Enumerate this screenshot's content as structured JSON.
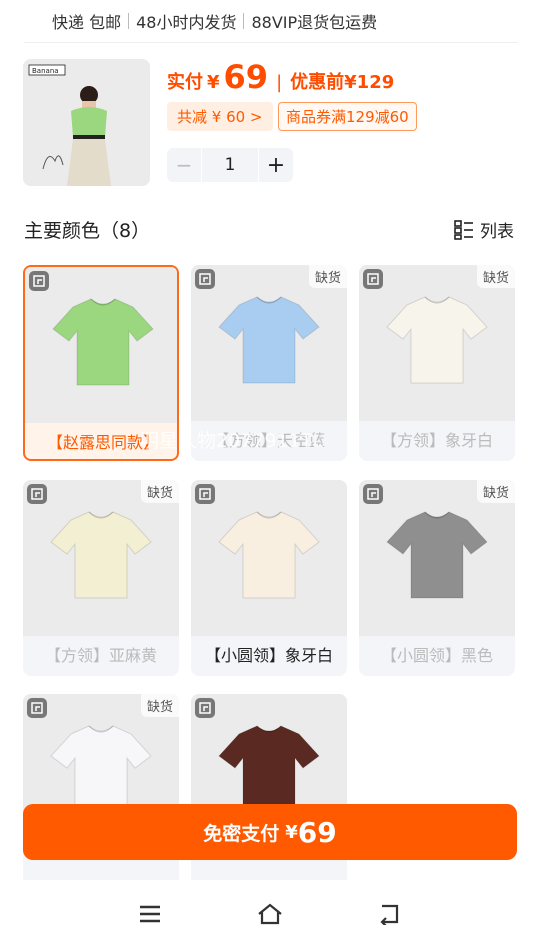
{
  "service": {
    "items": [
      "快递 包邮",
      "48小时内发货",
      "88VIP退货包运费"
    ]
  },
  "product": {
    "thumb_icon": "model-in-green-shirt-photo",
    "brand_label": "Banana",
    "price_label": "实付",
    "currency": "¥",
    "price": "69",
    "original_label": "优惠前",
    "original_price": "¥129",
    "discount_chip": "共减 ¥ 60 >",
    "coupon_chip": "商品券满129减60",
    "quantity": "1",
    "minus_symbol": "−",
    "plus_symbol": "+"
  },
  "colors": {
    "title": "主要颜色（8）",
    "list_toggle_label": "列表",
    "cards": [
      {
        "name": "【赵露思同款】",
        "stock": "",
        "selected": true,
        "instock": true,
        "color": "#9bd77f"
      },
      {
        "name": "【方领】天空蓝",
        "stock": "缺货",
        "selected": false,
        "instock": false,
        "color": "#a9cdf1"
      },
      {
        "name": "【方领】象牙白",
        "stock": "缺货",
        "selected": false,
        "instock": false,
        "color": "#f7f4ec"
      },
      {
        "name": "【方领】亚麻黄",
        "stock": "缺货",
        "selected": false,
        "instock": false,
        "color": "#f3efd2"
      },
      {
        "name": "【小圆领】象牙白",
        "stock": "",
        "selected": false,
        "instock": true,
        "color": "#f8efe1"
      },
      {
        "name": "【小圆领】黑色",
        "stock": "缺货",
        "selected": false,
        "instock": false,
        "color": "#8f8f8f"
      },
      {
        "name": "",
        "stock": "缺货",
        "selected": false,
        "instock": false,
        "color": "#f7f7fa"
      },
      {
        "name": "",
        "stock": "",
        "selected": false,
        "instock": true,
        "color": "#5a2a22"
      }
    ]
  },
  "overlay": "明星人物2077911TL",
  "pay": {
    "label": "免密支付",
    "currency": "¥",
    "amount": "69"
  },
  "nav": {
    "menu_icon": "menu-icon",
    "home_icon": "home-icon",
    "back_icon": "back-icon"
  }
}
